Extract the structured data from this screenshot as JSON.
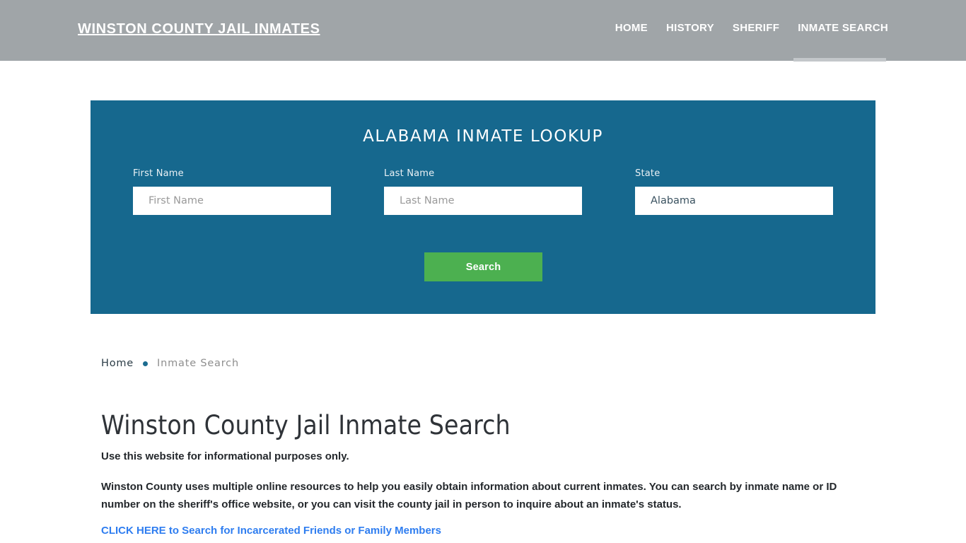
{
  "header": {
    "brand": "WINSTON COUNTY JAIL INMATES",
    "nav": [
      {
        "label": "HOME",
        "active": false
      },
      {
        "label": "HISTORY",
        "active": false
      },
      {
        "label": "SHERIFF",
        "active": false
      },
      {
        "label": "INMATE SEARCH",
        "active": true
      }
    ],
    "background_color": "#a0a5a8",
    "active_underline_color": "#c3c7ca"
  },
  "lookup": {
    "title": "ALABAMA INMATE LOOKUP",
    "panel_color": "#16688e",
    "fields": {
      "first_name": {
        "label": "First Name",
        "placeholder": "First Name",
        "value": ""
      },
      "last_name": {
        "label": "Last Name",
        "placeholder": "Last Name",
        "value": ""
      },
      "state": {
        "label": "State",
        "value": "Alabama",
        "options": [
          "Alabama"
        ]
      }
    },
    "submit_label": "Search",
    "submit_color": "#4cb050"
  },
  "breadcrumb": {
    "home": "Home",
    "separator": "•",
    "current": "Inmate Search",
    "separator_color": "#1c6c90"
  },
  "content": {
    "title": "Winston County Jail Inmate Search",
    "lede": "Use this website for informational purposes only.",
    "paragraph": "Winston County uses multiple online resources to help you easily obtain information about current inmates. You can search by inmate name or ID number on the sheriff's office website, or you can visit the county jail in person to inquire about an inmate's status.",
    "cta_link": "CLICK HERE to Search for Incarcerated Friends or Family Members",
    "cta_color": "#2e7df0"
  }
}
